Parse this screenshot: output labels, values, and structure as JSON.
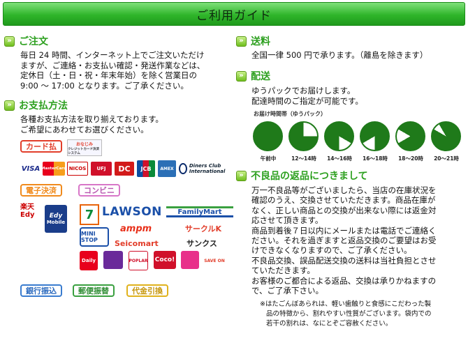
{
  "banner": {
    "title": "ご利用ガイド"
  },
  "order": {
    "title": "ご注文",
    "lines": [
      "毎日 24 時間、インターネット上でご注文いただけ",
      "ますが、ご連絡・お支払い確認・発送作業などは、",
      "定休日（土・日・祝・年末年始）を除く営業日の",
      "9:00 〜 17:00 となります。ご了承ください。"
    ]
  },
  "payment": {
    "title": "お支払方法",
    "lines": [
      "各種お支払方法を取り揃えております。",
      "ご希望にあわせてお選びください。"
    ],
    "card_label": "カード払",
    "card_logos": [
      "VISA",
      "MasterCard",
      "NICOS",
      "UFJ",
      "DC",
      "JCB",
      "AMEX",
      "Diners Club International"
    ],
    "credit_badge": {
      "top": "おなじみ",
      "bottom": "クレジットカード決済システム"
    },
    "e_payment_label": "電子決済",
    "convenience_label": "コンビニ",
    "e_logos": {
      "rakuten": "楽天 Edy",
      "edy": "Edy",
      "mobile": "Mobile"
    },
    "stores": [
      "LAWSON",
      "FamilyMart",
      "MINI STOP",
      "ampm",
      "サークルK",
      "Seicomart",
      "サンクス",
      "Daily",
      "POPLAR",
      "Coco!",
      "SAVE ON"
    ],
    "bank_label": "銀行振込",
    "postal_label": "郵便振替",
    "cod_label": "代金引換"
  },
  "shipping": {
    "title": "送料",
    "lines": [
      "全国一律 500 円で承ります。（離島を除きます）"
    ]
  },
  "delivery": {
    "title": "配送",
    "lines": [
      "ゆうパックでお届けします。",
      "配達時間のご指定が可能です。"
    ],
    "chart_caption": "お届け時間帯（ゆうパック）",
    "slots": [
      "午前中",
      "12〜14時",
      "14〜16時",
      "16〜18時",
      "18〜20時",
      "20〜21時"
    ]
  },
  "returns": {
    "title": "不良品の返品につきまして",
    "lines": [
      "万一不良品等がございましたら、当店の在庫状況を",
      "確認のうえ、交換させていただきます。商品在庫が",
      "なく、正しい商品との交換が出来ない際には返金対",
      "応させて頂きます。",
      "商品到着後７日以内にメールまたは電話でご連絡く",
      "ださい。それを過ぎますと返品交換のご要望はお受",
      "けできなくなりますので、ご了承ください。",
      "不良品交換、誤品配送交換の送料は当社負担とさせ",
      "ていただきます。",
      "お客様のご都合による返品、交換は承りかねますの",
      "で、ご了承下さい。"
    ],
    "note_lines": [
      "※はたごんぼあられは、軽い歯触りと食感にこだわった製",
      "品の特徴から、割れやすい性質がございます。袋内での",
      "若干の割れは、なにとぞご容赦ください。"
    ]
  }
}
